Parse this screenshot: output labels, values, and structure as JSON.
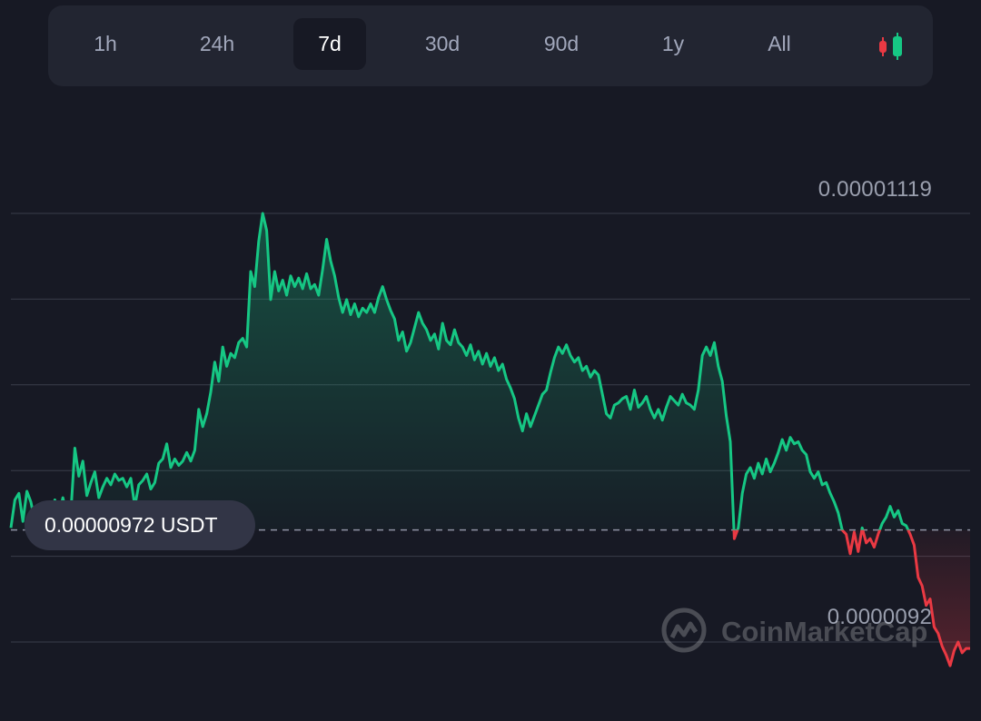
{
  "range_tabs": {
    "items": [
      {
        "label": "1h",
        "active": false
      },
      {
        "label": "24h",
        "active": false
      },
      {
        "label": "7d",
        "active": true
      },
      {
        "label": "30d",
        "active": false
      },
      {
        "label": "90d",
        "active": false
      },
      {
        "label": "1y",
        "active": false
      },
      {
        "label": "All",
        "active": false
      }
    ],
    "chart_type_icon": "candlestick-icon"
  },
  "current_price_label": "0.00000972 USDT",
  "watermark": "CoinMarketCap",
  "colors": {
    "background": "#171924",
    "up": "#16c784",
    "down": "#ea3943",
    "grid": "#3a3d4a",
    "pill": "#323546"
  },
  "chart_data": {
    "type": "area",
    "title": "",
    "xlabel": "",
    "ylabel": "",
    "reference_price": 9.72e-06,
    "yticks": [
      {
        "label": "0.00001119",
        "value": 1.119e-05
      },
      {
        "label": "0.0000092",
        "value": 9.2e-06
      }
    ],
    "ylim": [
      9.08e-06,
      1.13e-05
    ],
    "grid": true,
    "series": [
      {
        "values": [
          9.73e-06,
          9.86e-06,
          9.89e-06,
          9.76e-06,
          9.9e-06,
          9.85e-06,
          9.76e-06,
          9.82e-06,
          9.78e-06,
          9.84e-06,
          9.76e-06,
          9.86e-06,
          9.78e-06,
          9.87e-06,
          9.79e-06,
          9.8e-06,
          1.01e-05,
          9.97e-06,
          1.004e-05,
          9.88e-06,
          9.94e-06,
          9.99e-06,
          9.87e-06,
          9.92e-06,
          9.96e-06,
          9.93e-06,
          9.98e-06,
          9.95e-06,
          9.96e-06,
          9.92e-06,
          9.96e-06,
          9.83e-06,
          9.93e-06,
          9.95e-06,
          9.98e-06,
          9.91e-06,
          9.94e-06,
          1.003e-05,
          1.005e-05,
          1.012e-05,
          1.001e-05,
          1.005e-05,
          1.002e-05,
          1.004e-05,
          1.008e-05,
          1.004e-05,
          1.009e-05,
          1.028e-05,
          1.02e-05,
          1.026e-05,
          1.036e-05,
          1.05e-05,
          1.041e-05,
          1.057e-05,
          1.048e-05,
          1.054e-05,
          1.052e-05,
          1.059e-05,
          1.061e-05,
          1.057e-05,
          1.092e-05,
          1.085e-05,
          1.106e-05,
          1.119e-05,
          1.111e-05,
          1.079e-05,
          1.092e-05,
          1.083e-05,
          1.088e-05,
          1.081e-05,
          1.09e-05,
          1.085e-05,
          1.089e-05,
          1.084e-05,
          1.091e-05,
          1.084e-05,
          1.086e-05,
          1.081e-05,
          1.093e-05,
          1.107e-05,
          1.097e-05,
          1.09e-05,
          1.08e-05,
          1.073e-05,
          1.079e-05,
          1.072e-05,
          1.077e-05,
          1.071e-05,
          1.075e-05,
          1.073e-05,
          1.077e-05,
          1.073e-05,
          1.08e-05,
          1.085e-05,
          1.079e-05,
          1.074e-05,
          1.07e-05,
          1.06e-05,
          1.064e-05,
          1.055e-05,
          1.059e-05,
          1.066e-05,
          1.073e-05,
          1.068e-05,
          1.065e-05,
          1.06e-05,
          1.063e-05,
          1.056e-05,
          1.068e-05,
          1.06e-05,
          1.058e-05,
          1.065e-05,
          1.059e-05,
          1.057e-05,
          1.053e-05,
          1.058e-05,
          1.051e-05,
          1.055e-05,
          1.049e-05,
          1.054e-05,
          1.048e-05,
          1.052e-05,
          1.046e-05,
          1.049e-05,
          1.042e-05,
          1.038e-05,
          1.033e-05,
          1.024e-05,
          1.018e-05,
          1.026e-05,
          1.02e-05,
          1.025e-05,
          1.03e-05,
          1.035e-05,
          1.037e-05,
          1.045e-05,
          1.052e-05,
          1.057e-05,
          1.054e-05,
          1.058e-05,
          1.053e-05,
          1.05e-05,
          1.052e-05,
          1.046e-05,
          1.048e-05,
          1.043e-05,
          1.046e-05,
          1.044e-05,
          1.035e-05,
          1.026e-05,
          1.024e-05,
          1.03e-05,
          1.031e-05,
          1.033e-05,
          1.034e-05,
          1.028e-05,
          1.037e-05,
          1.029e-05,
          1.031e-05,
          1.034e-05,
          1.028e-05,
          1.024e-05,
          1.028e-05,
          1.023e-05,
          1.029e-05,
          1.034e-05,
          1.032e-05,
          1.03e-05,
          1.035e-05,
          1.031e-05,
          1.03e-05,
          1.028e-05,
          1.037e-05,
          1.053e-05,
          1.057e-05,
          1.053e-05,
          1.059e-05,
          1.048e-05,
          1.041e-05,
          1.025e-05,
          1.013e-05,
          9.68e-06,
          9.73e-06,
          9.89e-06,
          9.98e-06,
          1.001e-05,
          9.96e-06,
          1.003e-05,
          9.98e-06,
          1.005e-05,
          9.99e-06,
          1.003e-05,
          1.008e-05,
          1.014e-05,
          1.009e-05,
          1.015e-05,
          1.012e-05,
          1.013e-05,
          1.009e-05,
          1.007e-05,
          9.99e-06,
          9.96e-06,
          9.99e-06,
          9.93e-06,
          9.94e-06,
          9.89e-06,
          9.85e-06,
          9.8e-06,
          9.72e-06,
          9.7e-06,
          9.61e-06,
          9.71e-06,
          9.62e-06,
          9.73e-06,
          9.66e-06,
          9.68e-06,
          9.64e-06,
          9.7e-06,
          9.75e-06,
          9.78e-06,
          9.83e-06,
          9.78e-06,
          9.81e-06,
          9.75e-06,
          9.74e-06,
          9.7e-06,
          9.65e-06,
          9.5e-06,
          9.46e-06,
          9.37e-06,
          9.4e-06,
          9.27e-06,
          9.24e-06,
          9.18e-06,
          9.14e-06,
          9.09e-06,
          9.16e-06,
          9.2e-06,
          9.15e-06,
          9.17e-06,
          9.17e-06
        ]
      }
    ]
  }
}
